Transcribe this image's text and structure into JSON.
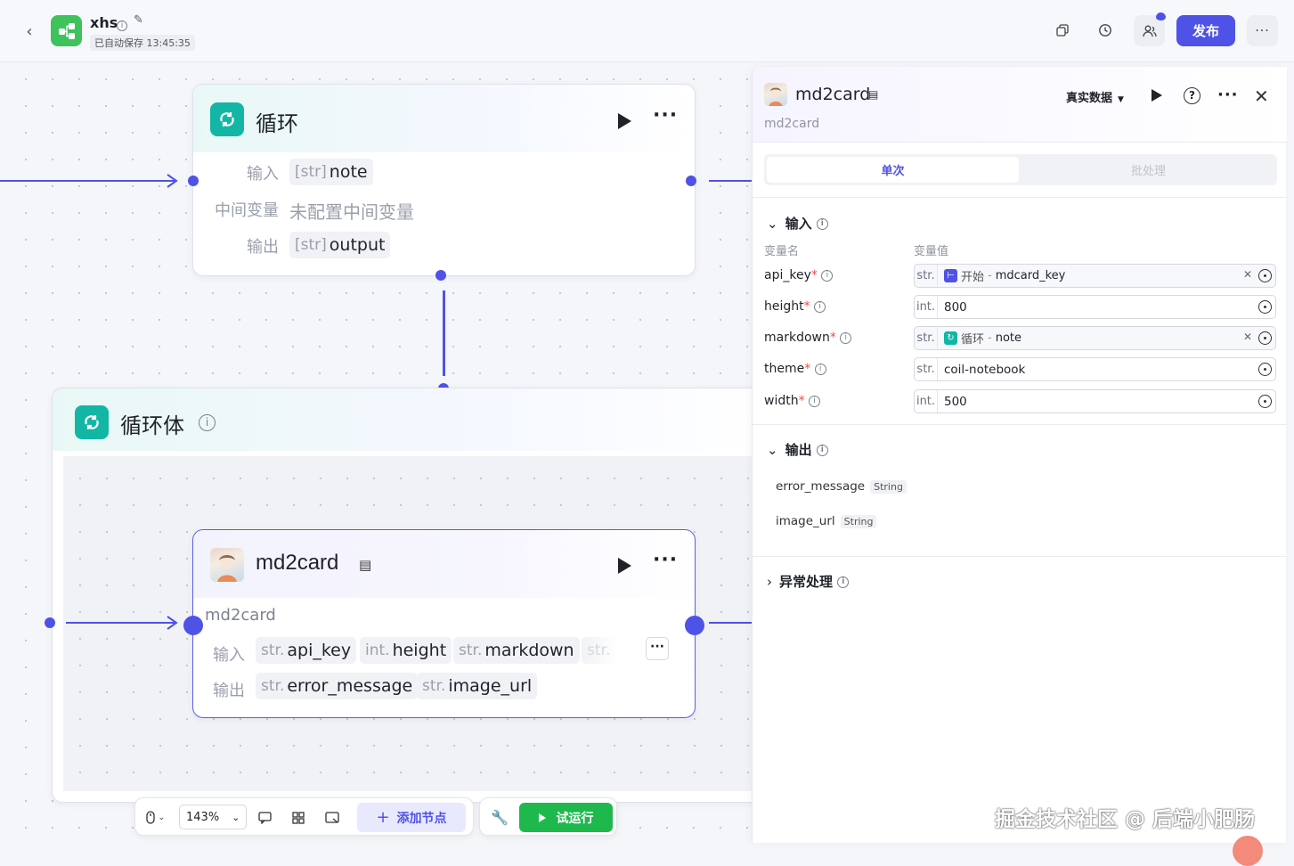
{
  "header": {
    "app_name": "xhs",
    "autosave": "已自动保存 13:45:35",
    "publish_label": "发布",
    "accent": "#4f52e6",
    "logo_color": "#3ec35c"
  },
  "loop_node": {
    "title": "循环",
    "input_label": "输入",
    "input_type": "[str]",
    "input_value": "note",
    "midvar_label": "中间变量",
    "midvar_value": "未配置中间变量",
    "output_label": "输出",
    "output_type": "[str]",
    "output_value": "output"
  },
  "loop_body": {
    "title": "循环体"
  },
  "md2card_node": {
    "title": "md2card",
    "subtitle": "md2card",
    "input_label": "输入",
    "output_label": "输出",
    "inputs": [
      {
        "type": "str.",
        "name": "api_key"
      },
      {
        "type": "int.",
        "name": "height"
      },
      {
        "type": "str.",
        "name": "markdown"
      },
      {
        "type": "str.",
        "name": ""
      }
    ],
    "outputs": [
      {
        "type": "str.",
        "name": "error_message"
      },
      {
        "type": "str.",
        "name": "image_url"
      }
    ]
  },
  "panel": {
    "title": "md2card",
    "subtitle": "md2card",
    "data_mode": "真实数据",
    "tabs": [
      "单次",
      "批处理"
    ],
    "input_section": "输入",
    "col_name": "变量名",
    "col_value": "变量值",
    "params": [
      {
        "name": "api_key",
        "type": "str.",
        "value": "mdcard_key",
        "ref": "开始",
        "is_ref": true
      },
      {
        "name": "height",
        "type": "int.",
        "value": "800",
        "ref": "",
        "is_ref": false
      },
      {
        "name": "markdown",
        "type": "str.",
        "value": "note",
        "ref": "循环",
        "is_ref": true
      },
      {
        "name": "theme",
        "type": "str.",
        "value": "coil-notebook",
        "ref": "",
        "is_ref": false
      },
      {
        "name": "width",
        "type": "int.",
        "value": "500",
        "ref": "",
        "is_ref": false
      }
    ],
    "output_section": "输出",
    "outputs": [
      {
        "name": "error_message",
        "type": "String"
      },
      {
        "name": "image_url",
        "type": "String"
      }
    ],
    "error_section": "异常处理"
  },
  "toolbar": {
    "zoom": "143%",
    "add_node": "添加节点",
    "test_run": "试运行"
  },
  "watermark": "掘金技术社区 @ 后端小肥肠"
}
